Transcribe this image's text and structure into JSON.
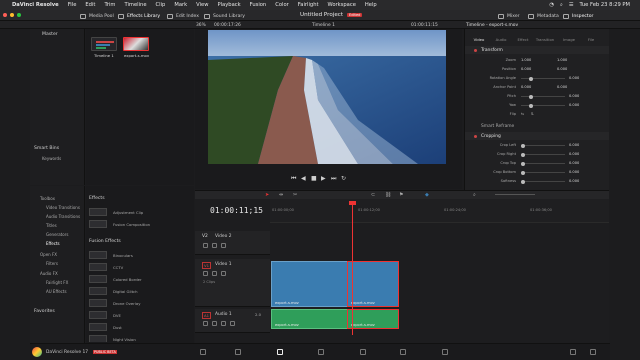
{
  "menubar": {
    "app": "DaVinci Resolve",
    "items": [
      "File",
      "Edit",
      "Trim",
      "Timeline",
      "Clip",
      "Mark",
      "View",
      "Playback",
      "Fusion",
      "Color",
      "Fairlight",
      "Workspace",
      "Help"
    ],
    "datetime": "Tue Feb 23  8:29 PM"
  },
  "toolbar": {
    "media_pool": "Media Pool",
    "effects_library": "Effects Library",
    "edit_index": "Edit Index",
    "sound_library": "Sound Library",
    "project_title": "Untitled Project",
    "project_status": "Edited",
    "mixer": "Mixer",
    "metadata": "Metadata",
    "inspector": "Inspector"
  },
  "subbar": {
    "zoom": "36%",
    "source_tc": "00:00:17:26",
    "timeline_name": "Timeline 1",
    "record_tc": "01:00:11:15",
    "inspector_header": "Timeline - export-s.mov"
  },
  "media_pool": {
    "bin_header": "Master",
    "smart_bins": "Smart Bins",
    "keywords": "Keywords",
    "clips": [
      {
        "name": "Timeline 1"
      },
      {
        "name": "export-s.mov"
      }
    ]
  },
  "effects": {
    "header": "Effects",
    "toolbox_items": [
      "Toolbox",
      "Video Transitions",
      "Audio Transitions",
      "Titles",
      "Generators",
      "Effects"
    ],
    "open_fx": [
      "Open FX",
      "Filters"
    ],
    "audio_fx": [
      "Audio FX",
      "Fairlight FX",
      "AU Effects"
    ],
    "favorites": "Favorites",
    "list": [
      "Adjustment Clip",
      "Fusion Composition"
    ],
    "fusion_header": "Fusion Effects",
    "fusion_list": [
      "Binoculars",
      "CCTV",
      "Colored Border",
      "Digital Glitch",
      "Drone Overlay",
      "DVE",
      "Dust",
      "Night Vision"
    ]
  },
  "inspector": {
    "tabs": [
      "Video",
      "Audio",
      "Effect",
      "Transition",
      "Image",
      "File"
    ],
    "transform_label": "Transform",
    "rows": [
      {
        "name": "Zoom",
        "x": "1.000",
        "y": "1.000"
      },
      {
        "name": "Position",
        "x": "0.000",
        "y": "0.000"
      },
      {
        "name": "Rotation Angle",
        "value": "0.000"
      },
      {
        "name": "Anchor Point",
        "x": "0.000",
        "y": "0.000"
      },
      {
        "name": "Pitch",
        "value": "0.000"
      },
      {
        "name": "Yaw",
        "value": "0.000"
      },
      {
        "name": "Flip",
        "value": ""
      }
    ],
    "smart_reframe": "Smart Reframe",
    "cropping_label": "Cropping",
    "crop_rows": [
      {
        "name": "Crop Left",
        "value": "0.000"
      },
      {
        "name": "Crop Right",
        "value": "0.000"
      },
      {
        "name": "Crop Top",
        "value": "0.000"
      },
      {
        "name": "Crop Bottom",
        "value": "0.000"
      },
      {
        "name": "Softness",
        "value": "0.000"
      }
    ]
  },
  "timeline": {
    "timecode": "01:00:11;15",
    "ruler_labels": [
      "01:00:00;00",
      "01:00:12;00",
      "01:00:24;00",
      "01:00:36;00"
    ],
    "tracks": [
      {
        "id": "V2",
        "name": "Video 2",
        "clips_note": ""
      },
      {
        "id": "V1",
        "name": "Video 1",
        "clips_note": "2 Clips"
      },
      {
        "id": "A1",
        "name": "Audio 1",
        "level": "2.0"
      }
    ],
    "video_clips": [
      {
        "label": "export-s.mov"
      },
      {
        "label": "export-s.mov"
      }
    ],
    "audio_clips": [
      {
        "label": "export-s.mov"
      },
      {
        "label": "export-s.mov"
      }
    ]
  },
  "bottom": {
    "app_label": "DaVinci Resolve 17",
    "beta_label": "PUBLIC BETA"
  }
}
